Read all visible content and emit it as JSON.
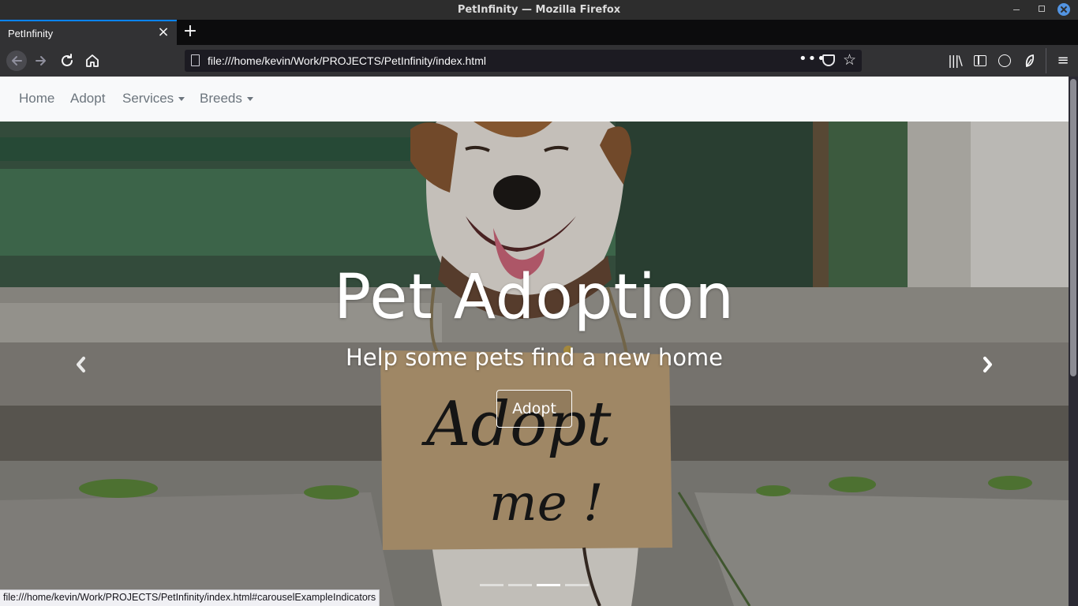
{
  "window": {
    "title": "PetInfinity — Mozilla Firefox"
  },
  "browser": {
    "tab_title": "PetInfinity",
    "tab_close": "×",
    "new_tab": "+",
    "url": "file:///home/kevin/Work/PROJECTS/PetInfinity/index.html",
    "url_more": "•••",
    "star": "☆",
    "library": "|||\\",
    "menu": "≡",
    "status_url": "file:///home/kevin/Work/PROJECTS/PetInfinity/index.html#carouselExampleIndicators"
  },
  "site_nav": {
    "items": [
      {
        "label": "Home"
      },
      {
        "label": "Adopt"
      },
      {
        "label": "Services",
        "dropdown": true
      },
      {
        "label": "Breeds",
        "dropdown": true
      }
    ]
  },
  "hero": {
    "title": "Pet Adoption",
    "subtitle": "Help some pets find a new home",
    "button": "Adopt",
    "sign_text": [
      "Adopt",
      "me !"
    ],
    "indicators": 4,
    "active_indicator": 3
  },
  "icons": {
    "back": "arrow-left-icon",
    "forward": "arrow-right-icon",
    "reload": "reload-icon",
    "home": "home-icon",
    "prev": "chevron-left-icon",
    "next": "chevron-right-icon"
  },
  "colors": {
    "accent": "#0a84ff",
    "toolbar": "#323234",
    "nav_text": "#6c757d",
    "nav_bg": "#f8f9fa"
  }
}
